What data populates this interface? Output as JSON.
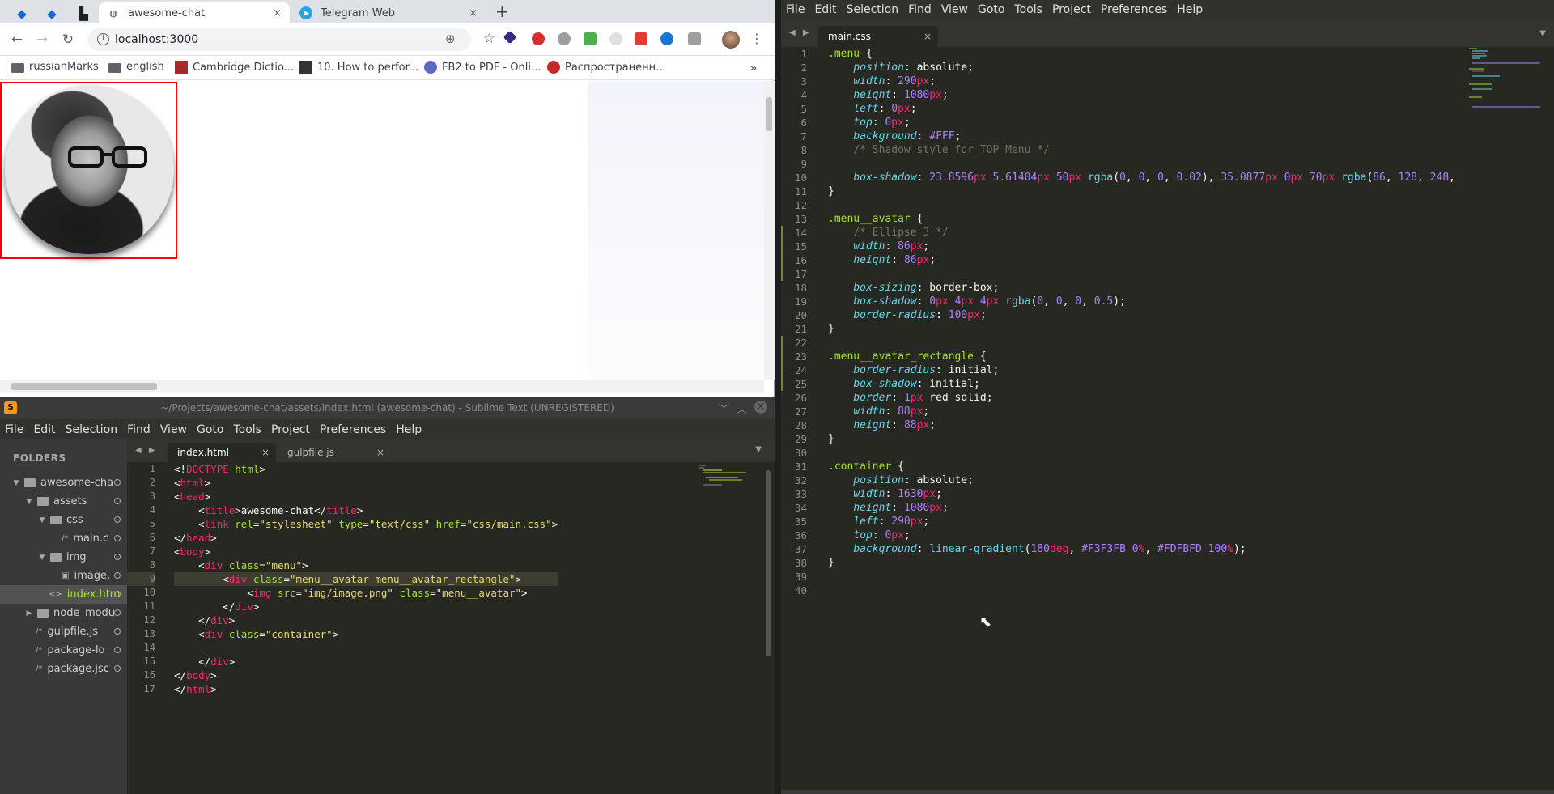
{
  "chrome": {
    "tabs": [
      {
        "label": "awesome-chat",
        "close": "×"
      },
      {
        "label": "Telegram Web",
        "close": "×"
      }
    ],
    "new_tab": "+",
    "url": "localhost:3000",
    "bookmarks": [
      "russianMarks",
      "english",
      "Cambridge Dictio...",
      "10. How to perfor...",
      "FB2 to PDF - Onli...",
      "Распространенн..."
    ],
    "bookmarks_more": "»",
    "colors": {
      "avatar_border": "#ff0000",
      "page_gradient_start": "#F3F3FB",
      "page_gradient_end": "#FDFBFD"
    }
  },
  "sublime_left": {
    "title": "~/Projects/awesome-chat/assets/index.html (awesome-chat) - Sublime Text (UNREGISTERED)",
    "menu": [
      "File",
      "Edit",
      "Selection",
      "Find",
      "View",
      "Goto",
      "Tools",
      "Project",
      "Preferences",
      "Help"
    ],
    "folders_header": "FOLDERS",
    "tree": [
      {
        "label": "awesome-cha",
        "type": "folder",
        "depth": 0,
        "open": true
      },
      {
        "label": "assets",
        "type": "folder",
        "depth": 1,
        "open": true
      },
      {
        "label": "css",
        "type": "folder",
        "depth": 2,
        "open": true
      },
      {
        "label": "main.c",
        "type": "file",
        "depth": 3,
        "icon": "/*"
      },
      {
        "label": "img",
        "type": "folder",
        "depth": 2,
        "open": true
      },
      {
        "label": "image.",
        "type": "file",
        "depth": 3,
        "icon": "img"
      },
      {
        "label": "index.htm",
        "type": "file",
        "depth": 2,
        "icon": "<>",
        "selected": true
      },
      {
        "label": "node_modu",
        "type": "folder",
        "depth": 1,
        "open": false
      },
      {
        "label": "gulpfile.js",
        "type": "file",
        "depth": 1,
        "icon": "/*"
      },
      {
        "label": "package-lo",
        "type": "file",
        "depth": 1,
        "icon": "/*"
      },
      {
        "label": "package.jsc",
        "type": "file",
        "depth": 1,
        "icon": "/*"
      }
    ],
    "tabs": [
      "index.html",
      "gulpfile.js"
    ],
    "close": "×"
  },
  "sublime_right": {
    "menu": [
      "File",
      "Edit",
      "Selection",
      "Find",
      "View",
      "Goto",
      "Tools",
      "Project",
      "Preferences",
      "Help"
    ],
    "tab": "main.css",
    "close": "×"
  }
}
